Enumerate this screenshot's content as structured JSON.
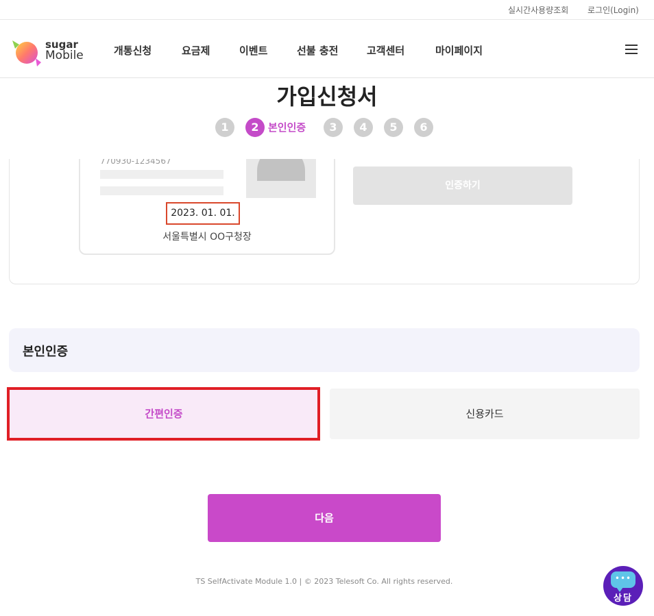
{
  "util_bar": {
    "usage_lookup": "실시간사용량조회",
    "login": "로그인(Login)"
  },
  "header": {
    "logo_line1": "sugar",
    "logo_line2": "Mobile",
    "nav": [
      "개통신청",
      "요금제",
      "이벤트",
      "선불 충전",
      "고객센터",
      "마이페이지"
    ]
  },
  "page": {
    "title": "가입신청서"
  },
  "steps": {
    "items": [
      "1",
      "2",
      "3",
      "4",
      "5",
      "6"
    ],
    "active_label": "본인인증",
    "active_index": 2
  },
  "id_card": {
    "number": "770930-1234567",
    "date": "2023. 01. 01.",
    "issuer": "서울특별시 OO구청장"
  },
  "verify_button": "인증하기",
  "auth_section": {
    "title": "본인인증",
    "options": [
      "간편인증",
      "신용카드"
    ],
    "selected": "간편인증"
  },
  "next_button": "다음",
  "footer": "TS SelfActivate Module 1.0 | © 2023 Telesoft Co. All rights reserved.",
  "chat": {
    "dots": "•••",
    "label": "상담"
  },
  "colors": {
    "accent": "#c44bc8",
    "highlight": "#e01f26",
    "next_button": "#c949c9",
    "chat_button": "#5b1fb8"
  },
  "icons": [
    "logo-candy-icon",
    "hamburger-menu-icon",
    "person-silhouette-icon",
    "chat-bubble-icon"
  ]
}
